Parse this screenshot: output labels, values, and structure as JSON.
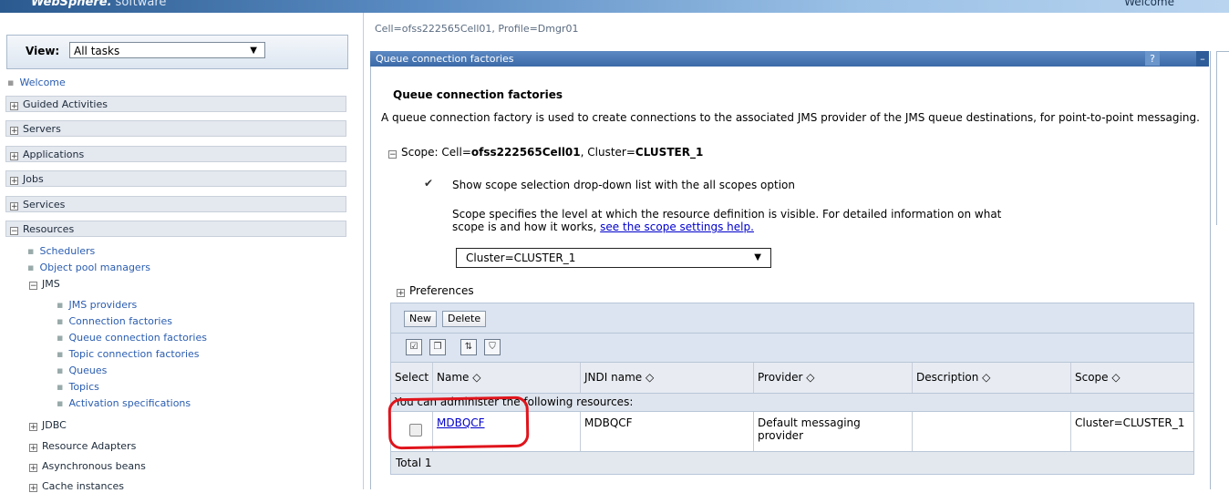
{
  "banner": {
    "brand": "WebSphere.",
    "brand2": "software",
    "welcome": "Welcome"
  },
  "nav": {
    "view_label": "View:",
    "view_value": "All tasks",
    "welcome": "Welcome",
    "categories": [
      "Guided Activities",
      "Servers",
      "Applications",
      "Jobs",
      "Services",
      "Resources"
    ],
    "resources_items": [
      "Schedulers",
      "Object pool managers"
    ],
    "jms_label": "JMS",
    "jms_items": [
      "JMS providers",
      "Connection factories",
      "Queue connection factories",
      "Topic connection factories",
      "Queues",
      "Topics",
      "Activation specifications"
    ],
    "after_jms": [
      "JDBC",
      "Resource Adapters",
      "Asynchronous beans",
      "Cache instances"
    ]
  },
  "content": {
    "breadcrumb": "Cell=ofss222565Cell01, Profile=Dmgr01",
    "panel_title": "Queue connection factories",
    "help": "?",
    "min": "–",
    "heading": "Queue connection factories",
    "description": "A queue connection factory is used to create connections to the associated JMS provider of the JMS queue destinations, for point-to-point messaging.",
    "scope_prefix": "Scope: Cell=",
    "scope_cell": "ofss222565Cell01",
    "scope_mid": ", Cluster=",
    "scope_cluster": "CLUSTER_1",
    "show_scope": "Show scope selection drop-down list with the all scopes option",
    "scope_help": "Scope specifies the level at which the resource definition is visible. For detailed information on what scope is and how it works,",
    "scope_help_link": "see the scope settings help.",
    "scope_select": "Cluster=CLUSTER_1",
    "preferences": "Preferences"
  },
  "table": {
    "new_label": "New",
    "delete_label": "Delete",
    "headers": [
      "Select",
      "Name ◇",
      "JNDI name ◇",
      "Provider ◇",
      "Description ◇",
      "Scope ◇"
    ],
    "admin_text": "You can administer the following resources:",
    "rows": [
      {
        "name": "MDBQCF",
        "jndi": "MDBQCF",
        "provider": "Default messaging provider",
        "description": "",
        "scope": "Cluster=CLUSTER_1"
      }
    ],
    "total": "Total 1"
  },
  "colors": {
    "accent": "#3b6aa8",
    "highlight": "#e0141c",
    "link": "#0000cc"
  }
}
